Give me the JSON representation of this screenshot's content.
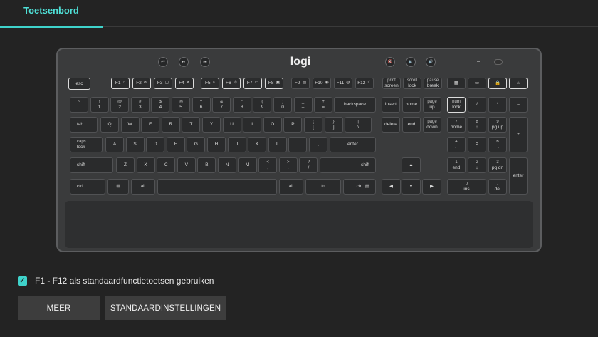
{
  "tabs": [
    {
      "label": "Toetsenbord"
    }
  ],
  "keyboard": {
    "brand": "logi",
    "media_keys": [
      "⏮",
      "⏯",
      "⏭"
    ],
    "volume_keys": [
      "🔇",
      "🔉",
      "🔊"
    ],
    "fkeys": [
      {
        "main": "F1",
        "sub": "⌂"
      },
      {
        "main": "F2",
        "sub": "✉"
      },
      {
        "main": "F3",
        "sub": "▢"
      },
      {
        "main": "F4",
        "sub": "✕"
      },
      {
        "main": "F5",
        "sub": "⌕"
      },
      {
        "main": "F6",
        "sub": "⚙"
      },
      {
        "main": "F7",
        "sub": "▭"
      },
      {
        "main": "F8",
        "sub": "▣"
      },
      {
        "main": "F9",
        "sub": "▤"
      },
      {
        "main": "F10",
        "sub": "◉"
      },
      {
        "main": "F11",
        "sub": "◍"
      },
      {
        "main": "F12",
        "sub": "☾"
      }
    ],
    "sys_keys": [
      "print screen",
      "scroll lock",
      "pause break"
    ],
    "special_keys": [
      "▦",
      "▭",
      "🔒",
      "⌂"
    ],
    "esc": "esc",
    "row1": [
      {
        "top": "~",
        "bot": "`"
      },
      {
        "top": "!",
        "bot": "1"
      },
      {
        "top": "@",
        "bot": "2"
      },
      {
        "top": "#",
        "bot": "3"
      },
      {
        "top": "$",
        "bot": "4"
      },
      {
        "top": "%",
        "bot": "5"
      },
      {
        "top": "^",
        "bot": "6"
      },
      {
        "top": "&",
        "bot": "7"
      },
      {
        "top": "*",
        "bot": "8"
      },
      {
        "top": "(",
        "bot": "9"
      },
      {
        "top": ")",
        "bot": "0"
      },
      {
        "top": "_",
        "bot": "–"
      },
      {
        "top": "+",
        "bot": "="
      }
    ],
    "backspace": "backspace",
    "tab_key": "tab",
    "row2": [
      "Q",
      "W",
      "E",
      "R",
      "T",
      "Y",
      "U",
      "I",
      "O",
      "P",
      {
        "top": "{",
        "bot": "["
      },
      {
        "top": "}",
        "bot": "]"
      },
      {
        "top": "|",
        "bot": "\\"
      }
    ],
    "caps": "caps lock",
    "row3": [
      "A",
      "S",
      "D",
      "F",
      "G",
      "H",
      "J",
      "K",
      "L",
      {
        "top": ":",
        "bot": ";"
      },
      {
        "top": "\"",
        "bot": "'"
      }
    ],
    "enter": "enter",
    "shift": "shift",
    "row4": [
      "Z",
      "X",
      "C",
      "V",
      "B",
      "N",
      "M",
      {
        "top": "<",
        "bot": ","
      },
      {
        "top": ">",
        "bot": "."
      },
      {
        "top": "?",
        "bot": "/"
      }
    ],
    "ctrl": "ctrl",
    "win": "⊞",
    "alt": "alt",
    "fn": "fn",
    "menu": "▤",
    "nav": [
      "insert",
      "home",
      "page up",
      "delete",
      "end",
      "page down"
    ],
    "arrows": [
      "▲",
      "◀",
      "▼",
      "▶"
    ],
    "numpad": [
      {
        "top": "num",
        "bot": "lock"
      },
      {
        "top": "",
        "bot": "/"
      },
      {
        "top": "",
        "bot": "*"
      },
      {
        "top": "",
        "bot": "–"
      },
      {
        "top": "7",
        "bot": "home"
      },
      {
        "top": "8",
        "bot": "↑"
      },
      {
        "top": "9",
        "bot": "pg up"
      },
      {
        "top": "",
        "bot": "+"
      },
      {
        "top": "4",
        "bot": "←"
      },
      {
        "top": "5",
        "bot": ""
      },
      {
        "top": "6",
        "bot": "→"
      },
      {
        "top": "1",
        "bot": "end"
      },
      {
        "top": "2",
        "bot": "↓"
      },
      {
        "top": "3",
        "bot": "pg dn"
      },
      {
        "top": "",
        "bot": "enter"
      },
      {
        "top": "0",
        "bot": "ins"
      },
      {
        "top": ".",
        "bot": "del"
      }
    ]
  },
  "settings": {
    "checkbox_label": "F1 - F12 als standaardfunctietoetsen gebruiken",
    "checked": true
  },
  "buttons": {
    "more": "MEER",
    "defaults": "STANDAARDINSTELLINGEN"
  },
  "colors": {
    "accent": "#3fd3cb",
    "background": "#232323"
  }
}
